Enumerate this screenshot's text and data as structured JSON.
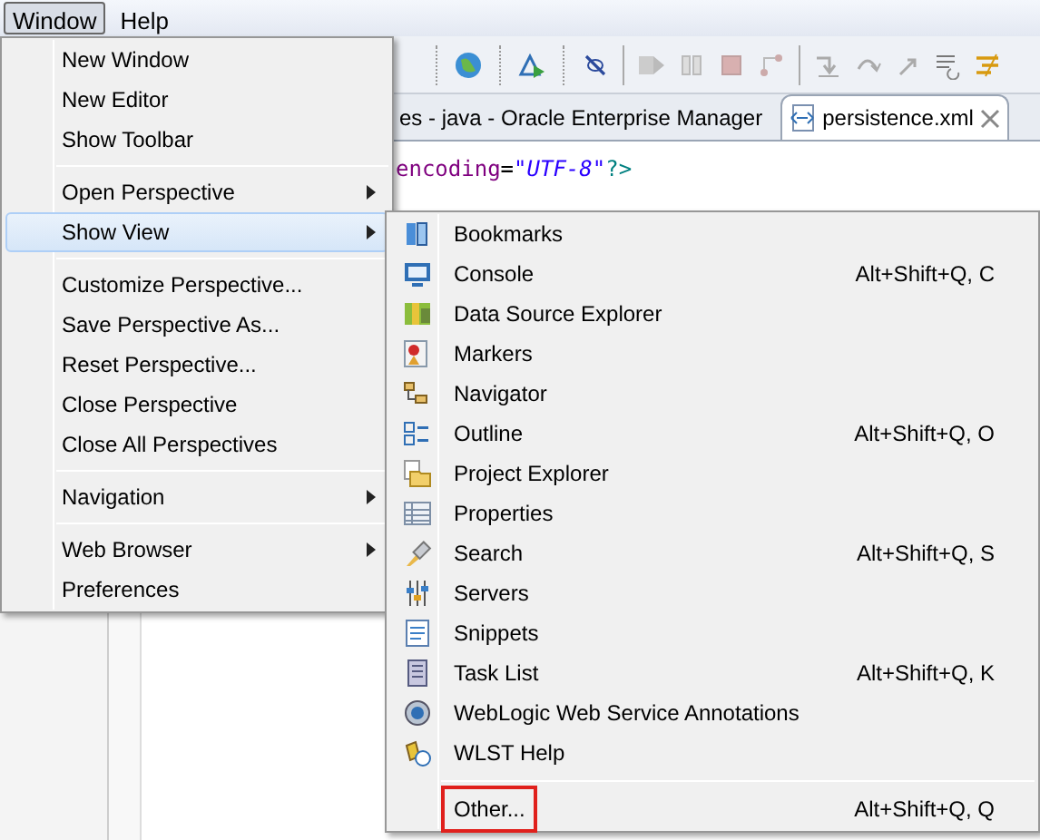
{
  "menubar": [
    {
      "label": "Window",
      "selected": true
    },
    {
      "label": "Help",
      "selected": false
    }
  ],
  "tabs": [
    {
      "label": "es - java - Oracle Enterprise Manager",
      "selected": false,
      "closable": false
    },
    {
      "label": "persistence.xml",
      "selected": true,
      "closable": true
    }
  ],
  "editor": {
    "lines": [
      [
        {
          "kind": "attr",
          "text": "encoding"
        },
        {
          "kind": "plain",
          "text": "="
        },
        {
          "kind": "string",
          "text": "\"UTF-8\""
        },
        {
          "kind": "tag",
          "text": "?>"
        }
      ]
    ]
  },
  "window_menu": {
    "groups": [
      [
        {
          "label": "New Window",
          "submenu": false,
          "selected": false
        },
        {
          "label": "New Editor",
          "submenu": false,
          "selected": false
        },
        {
          "label": "Show Toolbar",
          "submenu": false,
          "selected": false
        }
      ],
      [
        {
          "label": "Open Perspective",
          "submenu": true,
          "selected": false
        },
        {
          "label": "Show View",
          "submenu": true,
          "selected": true
        }
      ],
      [
        {
          "label": "Customize Perspective...",
          "submenu": false,
          "selected": false
        },
        {
          "label": "Save Perspective As...",
          "submenu": false,
          "selected": false
        },
        {
          "label": "Reset Perspective...",
          "submenu": false,
          "selected": false
        },
        {
          "label": "Close Perspective",
          "submenu": false,
          "selected": false
        },
        {
          "label": "Close All Perspectives",
          "submenu": false,
          "selected": false
        }
      ],
      [
        {
          "label": "Navigation",
          "submenu": true,
          "selected": false
        }
      ],
      [
        {
          "label": "Web Browser",
          "submenu": true,
          "selected": false
        },
        {
          "label": "Preferences",
          "submenu": false,
          "selected": false
        }
      ]
    ]
  },
  "show_view_menu": {
    "groups": [
      [
        {
          "label": "Bookmarks",
          "outlined": false
        },
        {
          "label": "Console",
          "shortcut": "Alt+Shift+Q, C",
          "outlined": false
        },
        {
          "label": "Data Source Explorer",
          "outlined": false
        },
        {
          "label": "Markers",
          "outlined": false
        },
        {
          "label": "Navigator",
          "outlined": false
        },
        {
          "label": "Outline",
          "shortcut": "Alt+Shift+Q, O",
          "outlined": false
        },
        {
          "label": "Project Explorer",
          "outlined": false
        },
        {
          "label": "Properties",
          "outlined": false
        },
        {
          "label": "Search",
          "shortcut": "Alt+Shift+Q, S",
          "outlined": false
        },
        {
          "label": "Servers",
          "outlined": false
        },
        {
          "label": "Snippets",
          "outlined": false
        },
        {
          "label": "Task List",
          "shortcut": "Alt+Shift+Q, K",
          "outlined": false
        },
        {
          "label": "WebLogic Web Service Annotations",
          "outlined": false
        },
        {
          "label": "WLST Help",
          "outlined": false
        }
      ],
      [
        {
          "label": "Other...",
          "shortcut": "Alt+Shift+Q, Q",
          "outlined": true
        }
      ]
    ]
  }
}
